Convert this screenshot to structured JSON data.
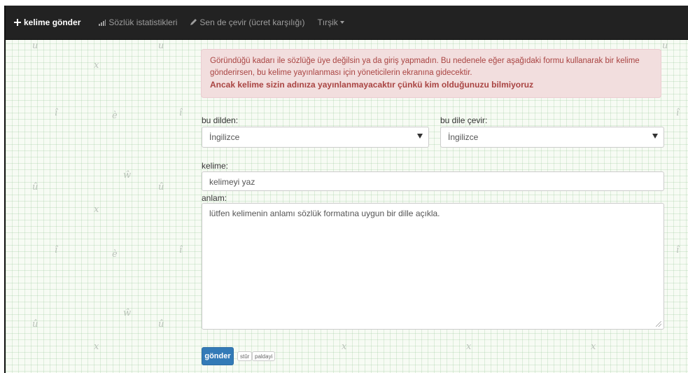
{
  "navbar": {
    "brand": "kelime gönder",
    "stats": "Sözlük istatistikleri",
    "translate": "Sen de çevir (ücret karşılığı)",
    "dropdown": "Tırşik"
  },
  "alert": {
    "message": "Göründüğü kadarı ile sözlüğe üye değilsin ya da giriş yapmadın. Bu nedenele eğer aşağıdaki formu kullanarak bir kelime gönderirsen, bu kelime yayınlanması için yöneticilerin ekranına gidecektir.",
    "warning": "Ancak kelime sizin adınıza yayınlanmayacaktır çünkü kim olduğunuzu bilmiyoruz"
  },
  "form": {
    "from_label": "bu dilden:",
    "from_value": "İngilizce",
    "to_label": "bu dile çevir:",
    "to_value": "İngilizce",
    "word_label": "kelime:",
    "word_placeholder": "kelimeyi yaz",
    "meaning_label": "anlam:",
    "meaning_placeholder": "lütfen kelimenin anlamı sözlük formatına uygun bir dille açıkla.",
    "submit": "gönder",
    "key_1": "stûr",
    "key_2": "paldayi"
  },
  "background_glyphs": [
    "u",
    "x",
    "î",
    "è",
    "ŵ",
    "û"
  ]
}
